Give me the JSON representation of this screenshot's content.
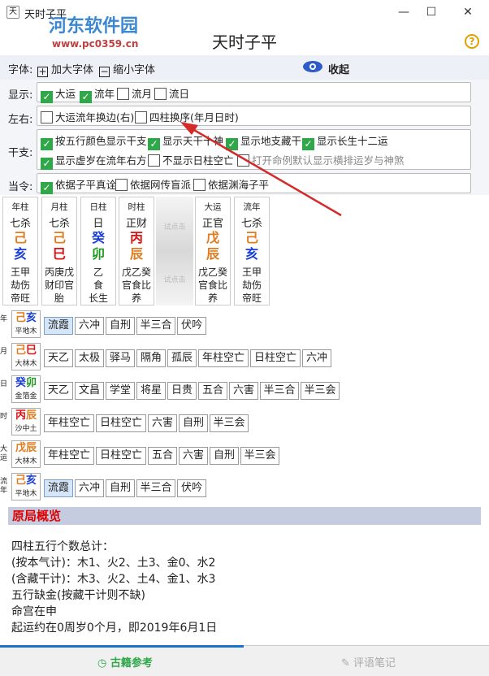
{
  "window": {
    "title": "天时子平",
    "close": "✕",
    "max": "☐",
    "min": "—"
  },
  "watermark": {
    "name": "河东软件园",
    "url": "www.pc0359.cn"
  },
  "app": {
    "title": "天时子平",
    "help": "?"
  },
  "toolbar": {
    "font_label": "字体:",
    "increase": "加大字体",
    "decrease": "缩小字体",
    "collapse": "收起"
  },
  "rows": {
    "display": {
      "label": "显示:",
      "options": [
        {
          "text": "大运",
          "checked": true
        },
        {
          "text": "流年",
          "checked": true
        },
        {
          "text": "流月",
          "checked": false
        },
        {
          "text": "流日",
          "checked": false
        }
      ]
    },
    "lr": {
      "label": "左右:",
      "options": [
        {
          "text": "大运流年换边(右)",
          "checked": false
        },
        {
          "text": "四柱换序(年月日时)",
          "checked": false
        }
      ]
    },
    "ganzhi": {
      "label": "干支:",
      "options": [
        {
          "text": "按五行颜色显示干支",
          "checked": true
        },
        {
          "text": "显示天干十神",
          "checked": true
        },
        {
          "text": "显示地支藏干",
          "checked": true
        },
        {
          "text": "显示长生十二运",
          "checked": true
        },
        {
          "text": "显示虚岁在流年右方",
          "checked": true
        },
        {
          "text": "不显示日柱空亡",
          "checked": false
        },
        {
          "text": "打开命例默认显示横排运岁与神煞",
          "checked": false
        }
      ]
    },
    "dangling": {
      "label": "当令:",
      "options": [
        {
          "text": "依据子平真诠",
          "checked": true
        },
        {
          "text": "依据网传盲派",
          "checked": false
        },
        {
          "text": "依据渊海子平",
          "checked": false
        }
      ]
    }
  },
  "pillars": [
    {
      "head": "年柱",
      "ten": "七杀",
      "gan": "己",
      "gan_color": "#e07b1e",
      "zhi": "亥",
      "zhi_color": "#1a3fd6",
      "hidden": [
        "王甲",
        "劫伤"
      ],
      "stage": "帝旺"
    },
    {
      "head": "月柱",
      "ten": "七杀",
      "gan": "己",
      "gan_color": "#e07b1e",
      "zhi": "巳",
      "zhi_color": "#e01010",
      "hidden": [
        "丙庚戊",
        "财印官"
      ],
      "stage": "胎"
    },
    {
      "head": "日柱",
      "ten": "日",
      "gan": "癸",
      "gan_color": "#1a3fd6",
      "zhi": "卯",
      "zhi_color": "#1e9a1e",
      "hidden": [
        "乙",
        "食"
      ],
      "stage": "长生"
    },
    {
      "head": "时柱",
      "ten": "正财",
      "gan": "丙",
      "gan_color": "#e01010",
      "zhi": "辰",
      "zhi_color": "#e07b1e",
      "hidden": [
        "戊乙癸",
        "官食比"
      ],
      "stage": "养"
    },
    {
      "head": "大运",
      "ten": "正官",
      "gan": "戊",
      "gan_color": "#e07b1e",
      "zhi": "辰",
      "zhi_color": "#e07b1e",
      "hidden": [
        "戊乙癸",
        "官食比"
      ],
      "stage": "养"
    },
    {
      "head": "流年",
      "ten": "七杀",
      "gan": "己",
      "gan_color": "#e07b1e",
      "zhi": "亥",
      "zhi_color": "#1a3fd6",
      "hidden": [
        "王甲",
        "劫伤"
      ],
      "stage": "帝旺"
    }
  ],
  "try_click": [
    "试点击",
    "试点击"
  ],
  "shensha": [
    {
      "side": "年",
      "gan": "己",
      "gan_color": "#e07b1e",
      "zhi": "亥",
      "zhi_color": "#1a3fd6",
      "nayin": "平地木",
      "items": [
        "流霞",
        "六冲",
        "自刑",
        "半三合",
        "伏吟"
      ],
      "selected": 0
    },
    {
      "side": "月",
      "gan": "己",
      "gan_color": "#e07b1e",
      "zhi": "巳",
      "zhi_color": "#e01010",
      "nayin": "大林木",
      "items": [
        "天乙",
        "太极",
        "驿马",
        "隔角",
        "孤辰",
        "年柱空亡",
        "日柱空亡",
        "六冲"
      ],
      "selected": -1
    },
    {
      "side": "日",
      "gan": "癸",
      "gan_color": "#1a3fd6",
      "zhi": "卯",
      "zhi_color": "#1e9a1e",
      "nayin": "金箔金",
      "items": [
        "天乙",
        "文昌",
        "学堂",
        "将星",
        "日贵",
        "五合",
        "六害",
        "半三合",
        "半三会"
      ],
      "selected": -1
    },
    {
      "side": "时",
      "gan": "丙",
      "gan_color": "#e01010",
      "zhi": "辰",
      "zhi_color": "#e07b1e",
      "nayin": "沙中土",
      "items": [
        "年柱空亡",
        "日柱空亡",
        "六害",
        "自刑",
        "半三会"
      ],
      "selected": -1
    },
    {
      "side": "大运",
      "gan": "戊",
      "gan_color": "#e07b1e",
      "zhi": "辰",
      "zhi_color": "#e07b1e",
      "nayin": "大林木",
      "items": [
        "年柱空亡",
        "日柱空亡",
        "五合",
        "六害",
        "自刑",
        "半三会"
      ],
      "selected": -1
    },
    {
      "side": "流年",
      "gan": "己",
      "gan_color": "#e07b1e",
      "zhi": "亥",
      "zhi_color": "#1a3fd6",
      "nayin": "平地木",
      "items": [
        "流霞",
        "六冲",
        "自刑",
        "半三合",
        "伏吟"
      ],
      "selected": 0
    }
  ],
  "summary": {
    "title": "原局概览",
    "lines": [
      "四柱五行个数总计：",
      "(按本气计)：木1、火2、土3、金0、水2",
      "(含藏干计)：木3、火2、土4、金1、水3",
      "五行缺金(按藏干计则不缺)",
      "命宫在申",
      "起运约在0周岁0个月，即2019年6月1日"
    ]
  },
  "bottom": {
    "left": "古籍参考",
    "right": "评语笔记"
  }
}
